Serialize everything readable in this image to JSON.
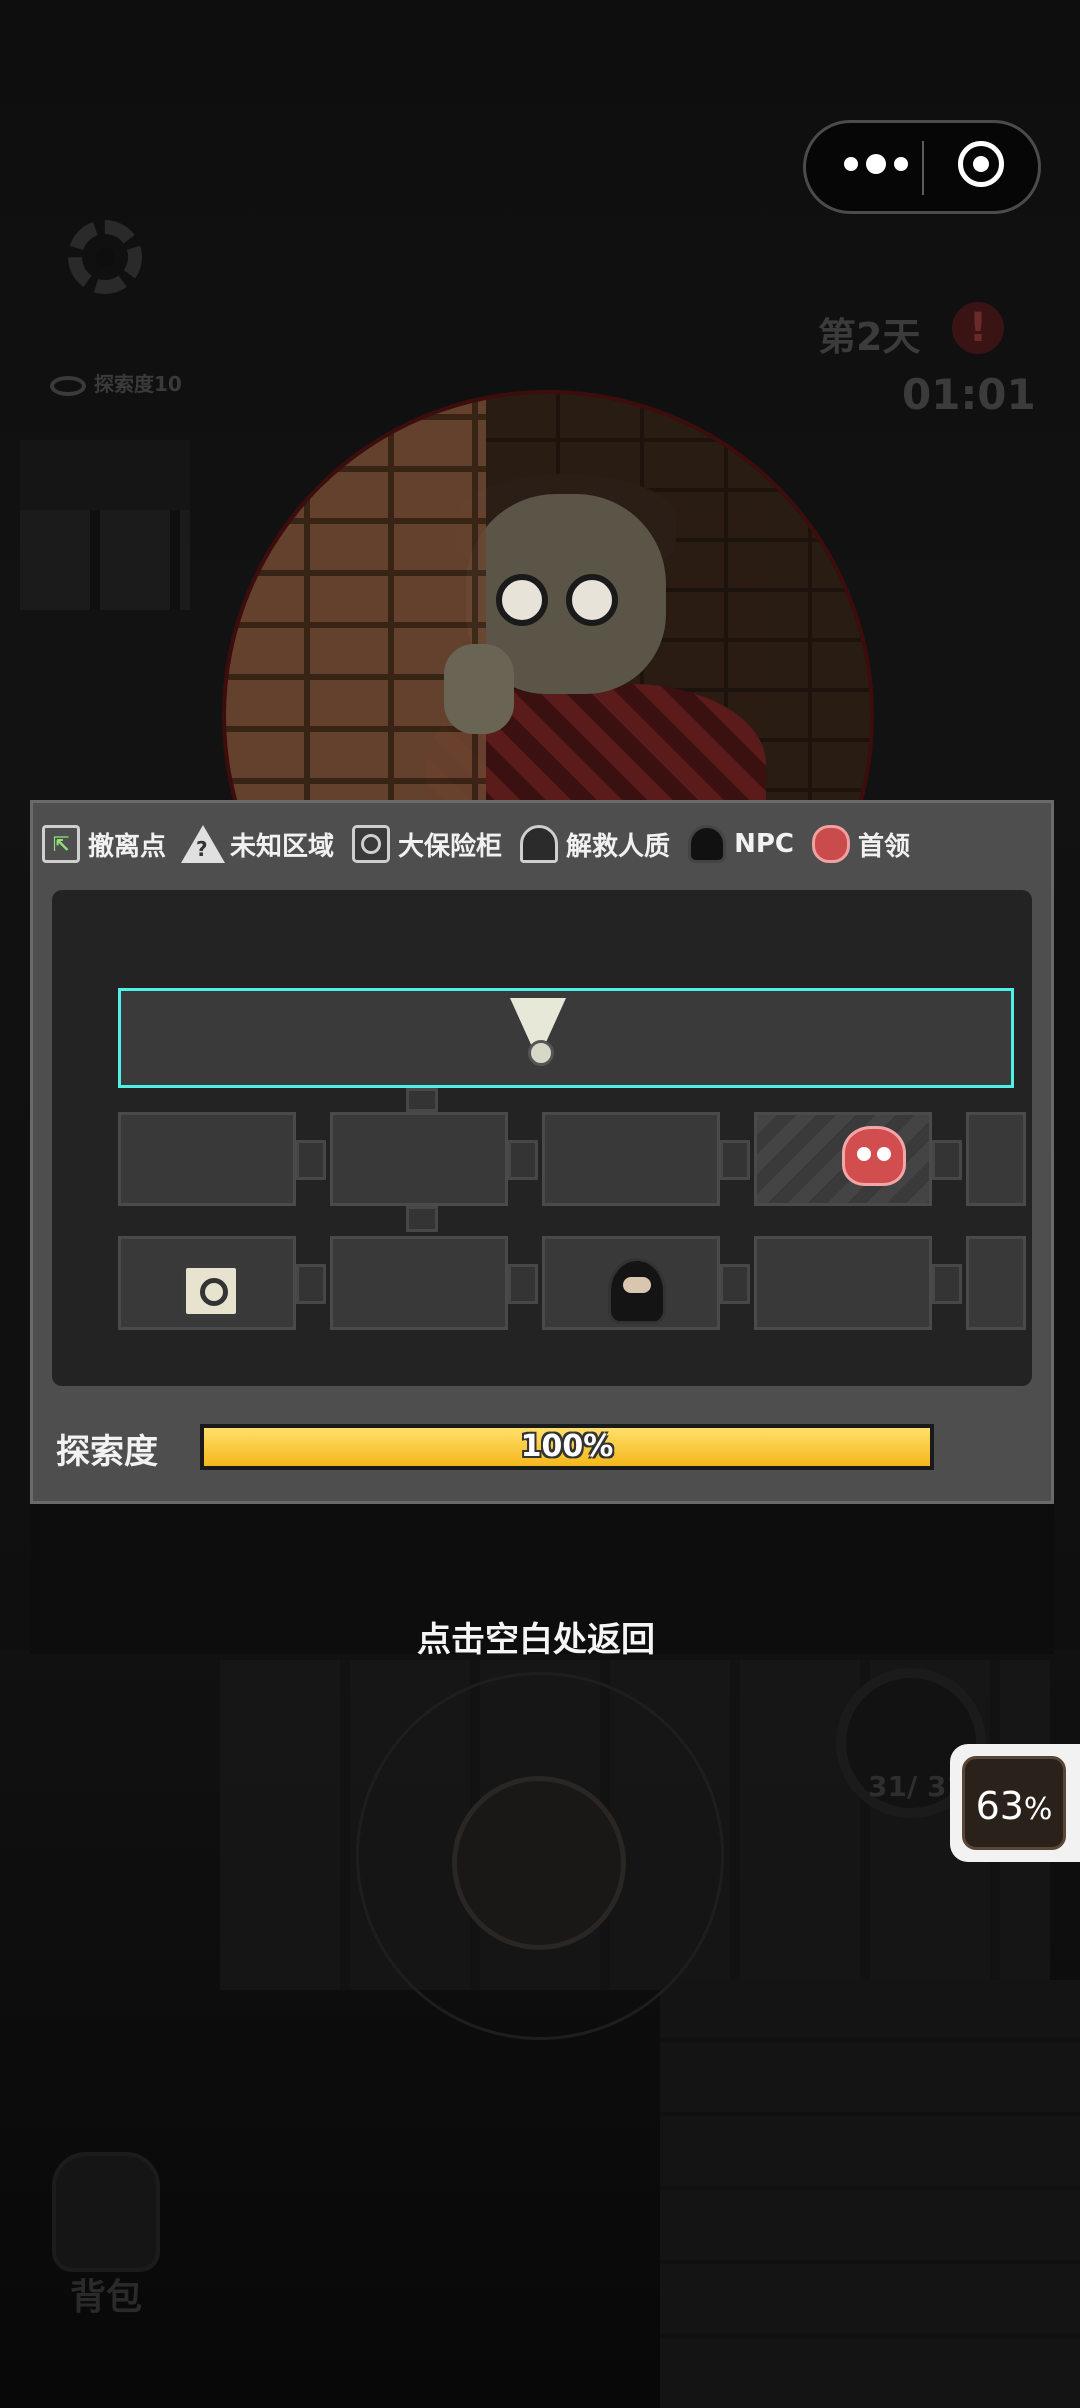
{
  "hud": {
    "explore_small": "探索度10",
    "day_label": "第2天",
    "alert_symbol": "!",
    "timer": "01:01",
    "ammo": "31/ 31",
    "battery_value": "63",
    "battery_unit": "%",
    "bag_label": "背包"
  },
  "legend": [
    {
      "label": "撤离点",
      "icon": "exit-icon"
    },
    {
      "label": "未知区域",
      "icon": "unknown-area-icon"
    },
    {
      "label": "大保险柜",
      "icon": "safe-icon"
    },
    {
      "label": "解救人质",
      "icon": "hostage-icon"
    },
    {
      "label": "NPC",
      "icon": "npc-icon"
    },
    {
      "label": "首领",
      "icon": "boss-icon"
    }
  ],
  "exploration": {
    "label": "探索度",
    "percent_text": "100%",
    "value": 1.0
  },
  "back_hint": "点击空白处返回",
  "colors": {
    "progress_fill": "#f7c325",
    "room_highlight": "#4ff0e6",
    "boss": "#d24d4d"
  }
}
